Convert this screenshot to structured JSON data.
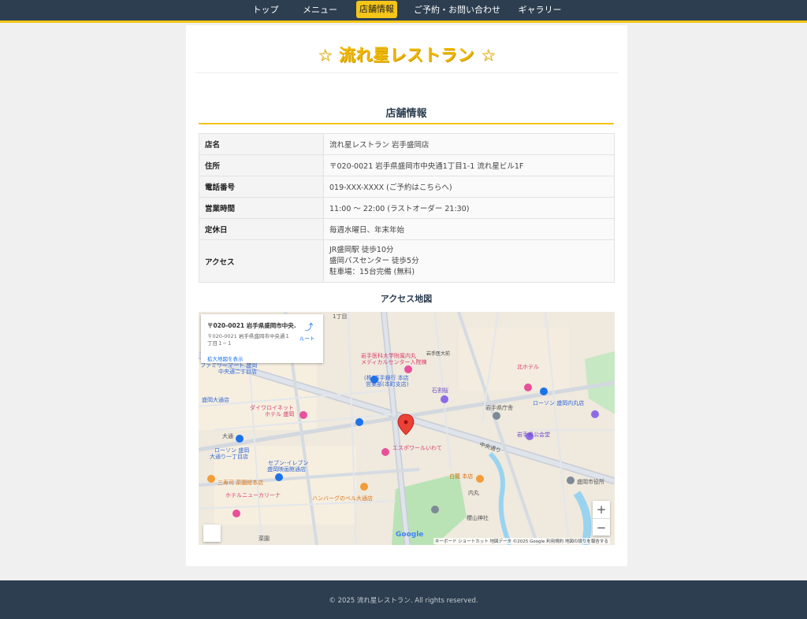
{
  "nav": {
    "items": [
      {
        "label": "トップ"
      },
      {
        "label": "メニュー"
      },
      {
        "label": "店舗情報"
      },
      {
        "label": "ご予約・お問い合わせ"
      },
      {
        "label": "ギャラリー"
      }
    ],
    "active_index": 2,
    "accent_color": "#f5c518",
    "bg_color": "#2c3e50"
  },
  "header": {
    "star_left": "☆",
    "title": "流れ星レストラン",
    "star_right": "☆"
  },
  "store_section": {
    "title": "店舗情報",
    "rows": [
      {
        "label": "店名",
        "value": [
          "流れ星レストラン 岩手盛岡店"
        ]
      },
      {
        "label": "住所",
        "value": [
          "〒020-0021 岩手県盛岡市中央通1丁目1-1 流れ星ビル1F"
        ]
      },
      {
        "label": "電話番号",
        "value": [
          "019-XXX-XXXX (ご予約はこちらへ)"
        ]
      },
      {
        "label": "営業時間",
        "value": [
          "11:00 〜 22:00 (ラストオーダー 21:30)"
        ]
      },
      {
        "label": "定休日",
        "value": [
          "毎週水曜日、年末年始"
        ]
      },
      {
        "label": "アクセス",
        "value": [
          "JR盛岡駅 徒歩10分",
          "盛岡バスセンター 徒歩5分",
          "駐車場：15台完備 (無料)"
        ]
      }
    ]
  },
  "access_map": {
    "title": "アクセス地図",
    "card": {
      "address_title": "〒020-0021 岩手県盛岡市中央...",
      "address_detail": "〒020-0021 岩手県盛岡市中央通１丁目１−１",
      "route_label": "ルート",
      "larger_map_link": "拡大地図を表示"
    },
    "zoom_in": "+",
    "zoom_out": "−",
    "google_logo": "Google",
    "attribution": "キーボード ショートカット   地図データ ©2025 Google   利用規約   地図の誤りを報告する",
    "labels": [
      {
        "text": "1丁目"
      },
      {
        "text": "岩手医科大学附属内丸"
      },
      {
        "text": "メディカルセンター入院棟"
      },
      {
        "text": "岩手医大前"
      },
      {
        "text": "北ホテル"
      },
      {
        "text": "(株)岩手銀行 本店"
      },
      {
        "text": "営業部(本町支店)"
      },
      {
        "text": "石割桜"
      },
      {
        "text": "岩手県庁舎"
      },
      {
        "text": "ローソン 盛岡内丸店"
      },
      {
        "text": "ファミリーマート 盛岡"
      },
      {
        "text": "中央通二丁目店"
      },
      {
        "text": "盛岡大通店"
      },
      {
        "text": "ダイワロイネット"
      },
      {
        "text": "ホテル 盛岡"
      },
      {
        "text": "大通"
      },
      {
        "text": "ローソン 盛岡"
      },
      {
        "text": "大通り一丁目店"
      },
      {
        "text": "岩手県公会堂"
      },
      {
        "text": "エスポワールいわて"
      },
      {
        "text": "セブン-イレブン"
      },
      {
        "text": "盛岡映画館通店"
      },
      {
        "text": "三寿司 菜園総本店"
      },
      {
        "text": "ホテルニューカリーナ"
      },
      {
        "text": "白龍 本店"
      },
      {
        "text": "盛岡市役所"
      },
      {
        "text": "ハンバーグのベル大通店"
      },
      {
        "text": "内丸"
      },
      {
        "text": "櫻山神社"
      },
      {
        "text": "中央通り"
      },
      {
        "text": "菜園"
      }
    ]
  },
  "footer": {
    "copyright": "© 2025 流れ星レストラン. All rights reserved."
  }
}
